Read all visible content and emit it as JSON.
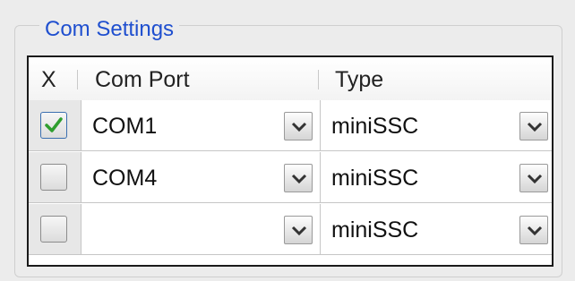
{
  "group": {
    "title": "Com Settings"
  },
  "grid": {
    "headers": {
      "x": "X",
      "com_port": "Com Port",
      "type": "Type"
    },
    "rows": [
      {
        "checked": true,
        "com_port": "COM1",
        "type": "miniSSC"
      },
      {
        "checked": false,
        "com_port": "COM4",
        "type": "miniSSC"
      },
      {
        "checked": false,
        "com_port": "",
        "type": "miniSSC"
      }
    ]
  },
  "colors": {
    "title": "#1f4fcf",
    "check": "#2f9e2f",
    "grid_border": "#1a1a1a"
  },
  "icons": {
    "dropdown": "chevron-down-icon",
    "checkmark": "checkmark-icon"
  }
}
